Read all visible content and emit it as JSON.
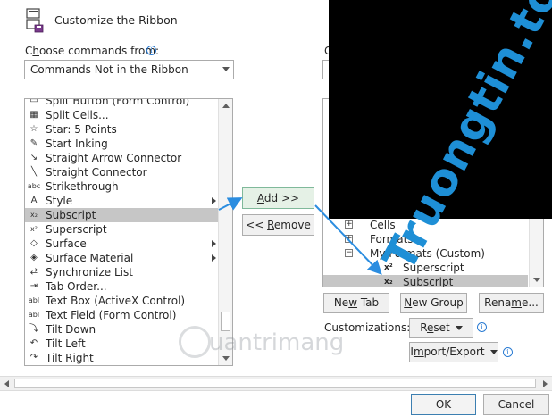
{
  "header": {
    "title": "Customize the Ribbon",
    "icon": "ribbon-customize-icon"
  },
  "left_panel": {
    "choose_label_pre": "C",
    "choose_label_underlined": "h",
    "choose_label_rest": "oose commands from:",
    "info_glyph": "i",
    "combo_value": "Commands Not in the Ribbon",
    "items": [
      {
        "label": "Split Button (Form Control)",
        "icon": "split-button-icon",
        "glyph": "▭",
        "submenu": false,
        "selected": false
      },
      {
        "label": "Split Cells...",
        "icon": "split-cells-icon",
        "glyph": "▦",
        "submenu": false,
        "selected": false
      },
      {
        "label": "Star: 5 Points",
        "icon": "star-icon",
        "glyph": "☆",
        "submenu": false,
        "selected": false
      },
      {
        "label": "Start Inking",
        "icon": "pen-icon",
        "glyph": "✎",
        "submenu": false,
        "selected": false
      },
      {
        "label": "Straight Arrow Connector",
        "icon": "arrow-connector-icon",
        "glyph": "↘",
        "submenu": false,
        "selected": false
      },
      {
        "label": "Straight Connector",
        "icon": "line-connector-icon",
        "glyph": "╲",
        "submenu": false,
        "selected": false
      },
      {
        "label": "Strikethrough",
        "icon": "strikethrough-icon",
        "glyph": "abc",
        "submenu": false,
        "selected": false
      },
      {
        "label": "Style",
        "icon": "style-icon",
        "glyph": "A",
        "submenu": true,
        "selected": false
      },
      {
        "label": "Subscript",
        "icon": "subscript-icon",
        "glyph": "x₂",
        "submenu": false,
        "selected": true
      },
      {
        "label": "Superscript",
        "icon": "superscript-icon",
        "glyph": "x²",
        "submenu": false,
        "selected": false
      },
      {
        "label": "Surface",
        "icon": "surface-icon",
        "glyph": "◇",
        "submenu": true,
        "selected": false
      },
      {
        "label": "Surface Material",
        "icon": "surface-material-icon",
        "glyph": "◈",
        "submenu": true,
        "selected": false
      },
      {
        "label": "Synchronize List",
        "icon": "sync-list-icon",
        "glyph": "⇄",
        "submenu": false,
        "selected": false
      },
      {
        "label": "Tab Order...",
        "icon": "tab-order-icon",
        "glyph": "⇥",
        "submenu": false,
        "selected": false
      },
      {
        "label": "Text Box (ActiveX Control)",
        "icon": "textbox-activex-icon",
        "glyph": "abl",
        "submenu": false,
        "selected": false
      },
      {
        "label": "Text Field (Form Control)",
        "icon": "text-field-icon",
        "glyph": "abl",
        "submenu": false,
        "selected": false
      },
      {
        "label": "Tilt Down",
        "icon": "tilt-down-icon",
        "glyph": "⤵",
        "submenu": false,
        "selected": false
      },
      {
        "label": "Tilt Left",
        "icon": "tilt-left-icon",
        "glyph": "↶",
        "submenu": false,
        "selected": false
      },
      {
        "label": "Tilt Right",
        "icon": "tilt-right-icon",
        "glyph": "↷",
        "submenu": false,
        "selected": false
      }
    ]
  },
  "middle": {
    "add_pre": "",
    "add_underlined": "A",
    "add_rest": "dd >>",
    "remove_pre": "<< ",
    "remove_underlined": "R",
    "remove_rest": "emove"
  },
  "right_panel": {
    "choose_label": "C",
    "tree": [
      {
        "label": "Cells",
        "expander": "+",
        "indent": 1,
        "selected": false,
        "glyph": ""
      },
      {
        "label": "Formats",
        "expander": "+",
        "indent": 1,
        "selected": false,
        "glyph": ""
      },
      {
        "label": "My Formats (Custom)",
        "expander": "−",
        "indent": 1,
        "selected": false,
        "glyph": ""
      },
      {
        "label": "Superscript",
        "expander": "",
        "indent": 2,
        "selected": false,
        "glyph": "x²"
      },
      {
        "label": "Subscript",
        "expander": "",
        "indent": 2,
        "selected": true,
        "glyph": "x₂"
      }
    ],
    "new_tab_pre": "Ne",
    "new_tab_underlined": "w",
    "new_tab_rest": " Tab",
    "new_group_pre": "",
    "new_group_underlined": "N",
    "new_group_rest": "ew Group",
    "rename_pre": "Rena",
    "rename_underlined": "m",
    "rename_rest": "e...",
    "customizations_label": "Customizations:",
    "reset_pre": "R",
    "reset_underlined": "e",
    "reset_rest": "set",
    "import_export_pre": "I",
    "import_export_underlined": "m",
    "import_export_rest": "port/Export",
    "info_glyph": "i"
  },
  "footer": {
    "ok_label": "OK",
    "cancel_label": "Cancel"
  },
  "watermarks": {
    "top_text": "Truongtin.top",
    "bottom_text": "uantrimang",
    "color_top": "#1e8fd6"
  },
  "colors": {
    "selection": "#c6c6c6",
    "add_button_bg": "#e5f1e6",
    "arrow": "#2b8de0",
    "info": "#2b7cd3"
  }
}
